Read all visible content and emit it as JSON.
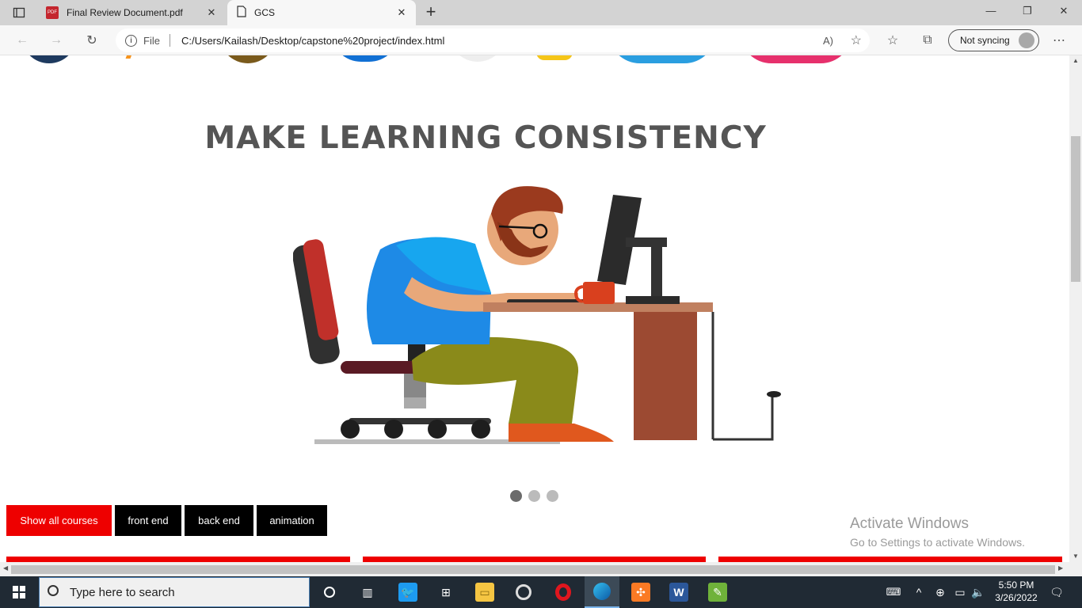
{
  "browser": {
    "tabs": [
      {
        "title": "Final Review Document.pdf",
        "icon": "pdf-icon",
        "active": false
      },
      {
        "title": "GCS",
        "icon": "page-icon",
        "active": true
      }
    ],
    "address": {
      "scheme_label": "File",
      "url": "C:/Users/Kailash/Desktop/capstone%20project/index.html"
    },
    "sync_label": "Not syncing"
  },
  "page": {
    "hero_title": "MAKE LEARNING CONSISTENCY",
    "carousel": {
      "slides": 3,
      "active_index": 0
    },
    "filters": [
      {
        "label": "Show all courses",
        "active": true
      },
      {
        "label": "front end",
        "active": false
      },
      {
        "label": "back end",
        "active": false
      },
      {
        "label": "animation",
        "active": false
      }
    ]
  },
  "watermark": {
    "line1": "Activate Windows",
    "line2": "Go to Settings to activate Windows."
  },
  "taskbar": {
    "search_placeholder": "Type here to search",
    "time": "5:50 PM",
    "date": "3/26/2022"
  },
  "colors": {
    "accent_red": "#ee0000",
    "filter_inactive": "#000000"
  }
}
